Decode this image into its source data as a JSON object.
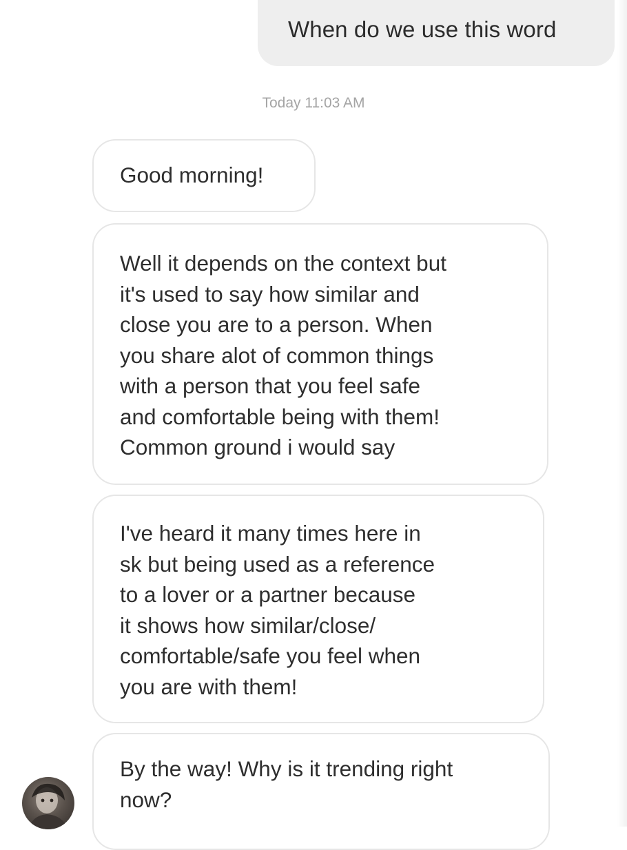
{
  "messages": {
    "sent_1": "When do we use this word",
    "timestamp": "Today 11:03 AM",
    "recv_1": "Good morning!",
    "recv_2": "Well it depends on the context but\nit's used to say how similar and\nclose you are to a person. When\nyou share alot of common things\nwith a person that you feel safe\nand comfortable being with them!\nCommon ground i would say",
    "recv_3": "I've heard it many times here in\nsk but being used as a reference\nto a lover or a partner because\nit shows how similar/close/\ncomfortable/safe you feel when\nyou are with them!",
    "recv_4": "By the way! Why is it trending right\nnow?"
  },
  "avatar": {
    "icon": "profile-photo"
  },
  "colors": {
    "sent_bubble": "#eeeeee",
    "recv_bubble_border": "#e6e6e6",
    "timestamp_text": "#a4a4a4",
    "text": "#2e2e2e"
  }
}
